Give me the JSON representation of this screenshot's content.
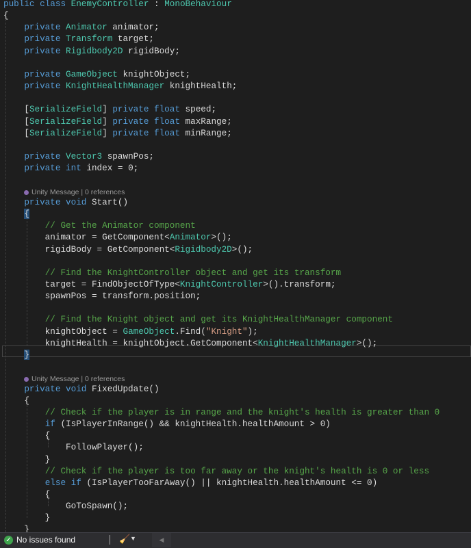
{
  "colors": {
    "background": "#1e1e1e",
    "keyword": "#569cd6",
    "type": "#4ec9b0",
    "comment": "#57a64a",
    "string": "#d69d85",
    "text": "#dcdcdc"
  },
  "codelens": [
    {
      "text": "Unity Message | 0 references"
    },
    {
      "text": "Unity Message | 0 references"
    }
  ],
  "code": [
    [
      [
        "k",
        "public class "
      ],
      [
        "t",
        "EnemyController"
      ],
      [
        "p",
        " : "
      ],
      [
        "t",
        "MonoBehaviour"
      ]
    ],
    [
      [
        "p",
        "{"
      ]
    ],
    [
      [
        "p",
        "    "
      ],
      [
        "k",
        "private "
      ],
      [
        "t",
        "Animator"
      ],
      [
        "p",
        " animator;"
      ]
    ],
    [
      [
        "p",
        "    "
      ],
      [
        "k",
        "private "
      ],
      [
        "t",
        "Transform"
      ],
      [
        "p",
        " target;"
      ]
    ],
    [
      [
        "p",
        "    "
      ],
      [
        "k",
        "private "
      ],
      [
        "t",
        "Rigidbody2D"
      ],
      [
        "p",
        " rigidBody;"
      ]
    ],
    [],
    [
      [
        "p",
        "    "
      ],
      [
        "k",
        "private "
      ],
      [
        "t",
        "GameObject"
      ],
      [
        "p",
        " knightObject;"
      ]
    ],
    [
      [
        "p",
        "    "
      ],
      [
        "k",
        "private "
      ],
      [
        "t",
        "KnightHealthManager"
      ],
      [
        "p",
        " knightHealth;"
      ]
    ],
    [],
    [
      [
        "p",
        "    ["
      ],
      [
        "t",
        "SerializeField"
      ],
      [
        "p",
        "] "
      ],
      [
        "k",
        "private float"
      ],
      [
        "p",
        " speed;"
      ]
    ],
    [
      [
        "p",
        "    ["
      ],
      [
        "t",
        "SerializeField"
      ],
      [
        "p",
        "] "
      ],
      [
        "k",
        "private float"
      ],
      [
        "p",
        " maxRange;"
      ]
    ],
    [
      [
        "p",
        "    ["
      ],
      [
        "t",
        "SerializeField"
      ],
      [
        "p",
        "] "
      ],
      [
        "k",
        "private float"
      ],
      [
        "p",
        " minRange;"
      ]
    ],
    [],
    [
      [
        "p",
        "    "
      ],
      [
        "k",
        "private "
      ],
      [
        "t",
        "Vector3"
      ],
      [
        "p",
        " spawnPos;"
      ]
    ],
    [
      [
        "p",
        "    "
      ],
      [
        "k",
        "private int"
      ],
      [
        "p",
        " index = 0;"
      ]
    ],
    [],
    [
      "LENS0"
    ],
    [
      [
        "p",
        "    "
      ],
      [
        "k",
        "private void"
      ],
      [
        "p",
        " Start()"
      ]
    ],
    [
      [
        "p",
        "    "
      ],
      [
        "bm",
        "{"
      ]
    ],
    [
      [
        "p",
        "        "
      ],
      [
        "c",
        "// Get the Animator component"
      ]
    ],
    [
      [
        "p",
        "        animator = GetComponent<"
      ],
      [
        "t",
        "Animator"
      ],
      [
        "p",
        ">();"
      ]
    ],
    [
      [
        "p",
        "        rigidBody = GetComponent<"
      ],
      [
        "t",
        "Rigidbody2D"
      ],
      [
        "p",
        ">();"
      ]
    ],
    [],
    [
      [
        "p",
        "        "
      ],
      [
        "c",
        "// Find the KnightController object and get its transform"
      ]
    ],
    [
      [
        "p",
        "        target = FindObjectOfType<"
      ],
      [
        "t",
        "KnightController"
      ],
      [
        "p",
        ">().transform;"
      ]
    ],
    [
      [
        "p",
        "        spawnPos = transform.position;"
      ]
    ],
    [],
    [
      [
        "p",
        "        "
      ],
      [
        "c",
        "// Find the Knight object and get its KnightHealthManager component"
      ]
    ],
    [
      [
        "p",
        "        knightObject = "
      ],
      [
        "t",
        "GameObject"
      ],
      [
        "p",
        ".Find("
      ],
      [
        "s",
        "\"Knight\""
      ],
      [
        "p",
        ");"
      ]
    ],
    [
      [
        "p",
        "        knightHealth = knightObject.GetComponent<"
      ],
      [
        "t",
        "KnightHealthManager"
      ],
      [
        "p",
        ">();"
      ]
    ],
    [
      [
        "p",
        "    "
      ],
      [
        "bm",
        "}"
      ]
    ],
    [],
    [
      "LENS1"
    ],
    [
      [
        "p",
        "    "
      ],
      [
        "k",
        "private void"
      ],
      [
        "p",
        " FixedUpdate()"
      ]
    ],
    [
      [
        "p",
        "    {"
      ]
    ],
    [
      [
        "p",
        "        "
      ],
      [
        "c",
        "// Check if the player is in range and the knight's health is greater than 0"
      ]
    ],
    [
      [
        "p",
        "        "
      ],
      [
        "k",
        "if"
      ],
      [
        "p",
        " (IsPlayerInRange() && knightHealth.healthAmount > 0)"
      ]
    ],
    [
      [
        "p",
        "        {"
      ]
    ],
    [
      [
        "p",
        "            FollowPlayer();"
      ]
    ],
    [
      [
        "p",
        "        }"
      ]
    ],
    [
      [
        "p",
        "        "
      ],
      [
        "c",
        "// Check if the player is too far away or the knight's health is 0 or less"
      ]
    ],
    [
      [
        "p",
        "        "
      ],
      [
        "k",
        "else if"
      ],
      [
        "p",
        " (IsPlayerTooFarAway() || knightHealth.healthAmount <= 0)"
      ]
    ],
    [
      [
        "p",
        "        {"
      ]
    ],
    [
      [
        "p",
        "            GoToSpawn();"
      ]
    ],
    [
      [
        "p",
        "        }"
      ]
    ],
    [
      [
        "p",
        "    }"
      ]
    ]
  ],
  "status": {
    "issues": "No issues found",
    "check_icon": "check-circle-icon",
    "cleanup_icon": "brush-icon"
  }
}
